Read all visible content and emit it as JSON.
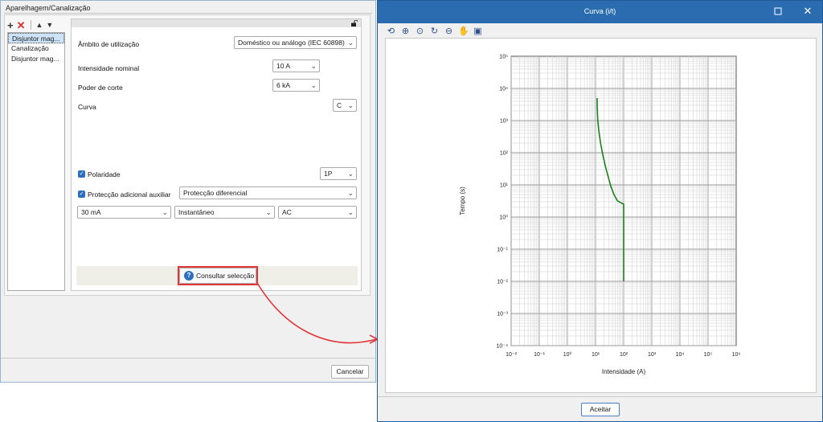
{
  "left": {
    "title": "Aparelhagem/Canalização",
    "list_items": [
      "Disjuntor mag...",
      "Canalização",
      "Disjuntor mag..."
    ],
    "ambito_label": "Âmbito de utilização",
    "ambito_value": "Doméstico ou análogo (IEC 60898)",
    "intensidade_label": "Intensidade nominal",
    "intensidade_value": "10 A",
    "poder_label": "Poder de corte",
    "poder_value": "6 kA",
    "curva_label": "Curva",
    "curva_value": "C",
    "polaridade_label": "Polaridade",
    "polaridade_value": "1P",
    "proteccao_label": "Protecção adicional auxiliar",
    "proteccao_value": "Protecção diferencial",
    "sens_value": "30 mA",
    "tipo_value": "Instantâneo",
    "classe_value": "AC",
    "consult_label": "Consultar selecção",
    "cancel_label": "Cancelar"
  },
  "right": {
    "title": "Curva (i/t)",
    "accept_label": "Aceitar",
    "toolbar_icons": [
      "zoom-fit-icon",
      "zoom-in-icon",
      "zoom-window-icon",
      "refresh-icon",
      "zoom-out-icon",
      "pan-hand-icon",
      "export-icon"
    ]
  },
  "chart_data": {
    "type": "line",
    "xlabel": "Intensidade (A)",
    "ylabel": "Tempo (s)",
    "xscale": "log",
    "yscale": "log",
    "xlim": [
      0.01,
      1000000
    ],
    "ylim": [
      0.0001,
      100000
    ],
    "x_ticks": [
      "10⁻²",
      "10⁻¹",
      "10⁰",
      "10¹",
      "10²",
      "10³",
      "10⁴",
      "10⁵",
      "10⁶"
    ],
    "y_ticks": [
      "10⁵",
      "10⁴",
      "10³",
      "10²",
      "10¹",
      "10⁰",
      "10⁻¹",
      "10⁻²",
      "10⁻³",
      "10⁻⁴"
    ],
    "grid": true,
    "color": "#1a7f1a",
    "series": [
      {
        "x": [
          11.3,
          11.5,
          12,
          13,
          15,
          18,
          22,
          28,
          35,
          45,
          60,
          100,
          100
        ],
        "y": [
          5000,
          2500,
          1000,
          500,
          200,
          90,
          40,
          18,
          9,
          5,
          3.2,
          2.5,
          0.01
        ]
      }
    ]
  }
}
